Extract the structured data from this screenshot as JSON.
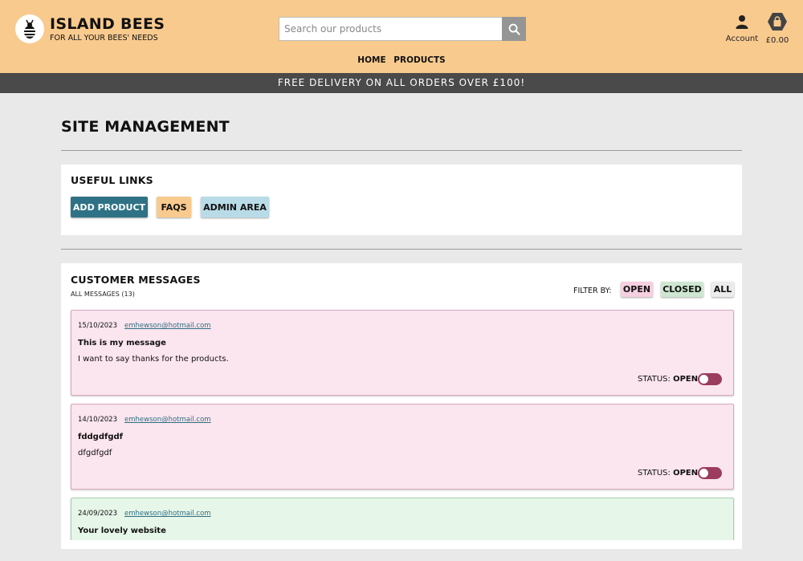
{
  "brand": {
    "name": "ISLAND BEES",
    "tagline": "FOR ALL YOUR BEES' NEEDS",
    "icon": "bee-logo-icon"
  },
  "search": {
    "placeholder": "Search our products",
    "value": "",
    "icon": "search-icon"
  },
  "account": {
    "label": "Account",
    "icon": "user-icon"
  },
  "bag": {
    "total": "£0.00",
    "icon": "shopping-bag-icon"
  },
  "nav": {
    "items": [
      "HOME",
      "PRODUCTS"
    ]
  },
  "banner": {
    "text": "FREE DELIVERY ON ALL ORDERS OVER £100!"
  },
  "page": {
    "title": "SITE MANAGEMENT"
  },
  "useful_links": {
    "title": "USEFUL LINKS",
    "buttons": [
      "ADD PRODUCT",
      "FAQS",
      "ADMIN AREA"
    ]
  },
  "customer_messages": {
    "title": "CUSTOMER MESSAGES",
    "count_label": "ALL MESSAGES (13)",
    "filter_label": "FILTER BY:",
    "filters": [
      "OPEN",
      "CLOSED",
      "ALL"
    ],
    "status_prefix": "STATUS:",
    "messages": [
      {
        "date": "15/10/2023",
        "email": "emhewson@hotmail.com",
        "subject": "This is my message",
        "body": "I want to say thanks for the products.",
        "status": "OPEN"
      },
      {
        "date": "14/10/2023",
        "email": "emhewson@hotmail.com",
        "subject": "fddgdfgdf",
        "body": "dfgdfgdf",
        "status": "OPEN"
      },
      {
        "date": "24/09/2023",
        "email": "emhewson@hotmail.com",
        "subject": "Your lovely website",
        "body": "",
        "status": ""
      }
    ]
  },
  "colors": {
    "header_bg": "#f9ca8e",
    "banner_bg": "#4a4a4a",
    "primary_button": "#2f7286",
    "open_message_bg": "#fbe5ee",
    "closed_message_bg": "#e6f6e8",
    "toggle_on": "#9c3c5e"
  }
}
